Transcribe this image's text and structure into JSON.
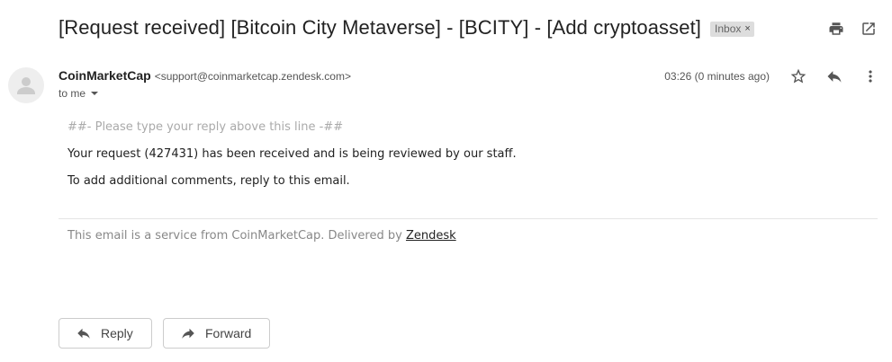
{
  "subject": "[Request received] [Bitcoin City Metaverse] - [BCITY] - [Add cryptoasset]",
  "label": {
    "text": "Inbox",
    "remove_glyph": "×"
  },
  "top_icons": [
    "print-icon",
    "open-in-new-window-icon"
  ],
  "sender": {
    "name": "CoinMarketCap",
    "email": "<support@coinmarketcap.zendesk.com>",
    "recipients": "to me"
  },
  "time": "03:26 (0 minutes ago)",
  "message_icons": [
    "star-icon",
    "reply-icon",
    "more-vert-icon"
  ],
  "body": {
    "placeholder": "##- Please type your reply above this line -##",
    "line1": "Your request (427431) has been received and is being reviewed by our staff.",
    "line2": "To add additional comments, reply to this email."
  },
  "footer": {
    "text": "This email is a service from CoinMarketCap. Delivered by",
    "link": "Zendesk"
  },
  "actions": {
    "reply": "Reply",
    "forward": "Forward"
  }
}
